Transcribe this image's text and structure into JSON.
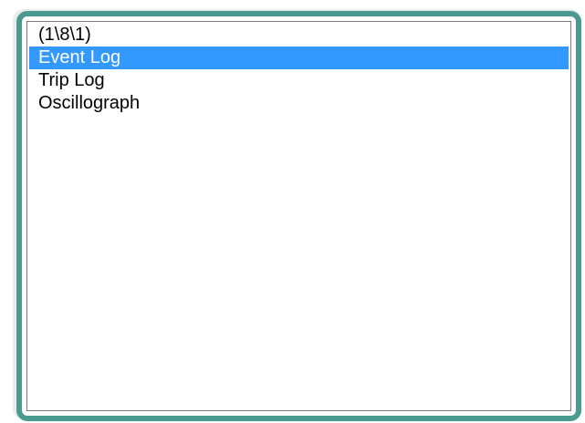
{
  "listbox": {
    "items": [
      {
        "label": "(1\\8\\1)"
      },
      {
        "label": "Event Log",
        "selected": true
      },
      {
        "label": "Trip Log"
      },
      {
        "label": "Oscillograph"
      }
    ],
    "selected_index": 1
  },
  "colors": {
    "frame": "#4a9a90",
    "selection": "#3399ff",
    "selection_text": "#ffffff",
    "text": "#000000",
    "background": "#ffffff"
  }
}
